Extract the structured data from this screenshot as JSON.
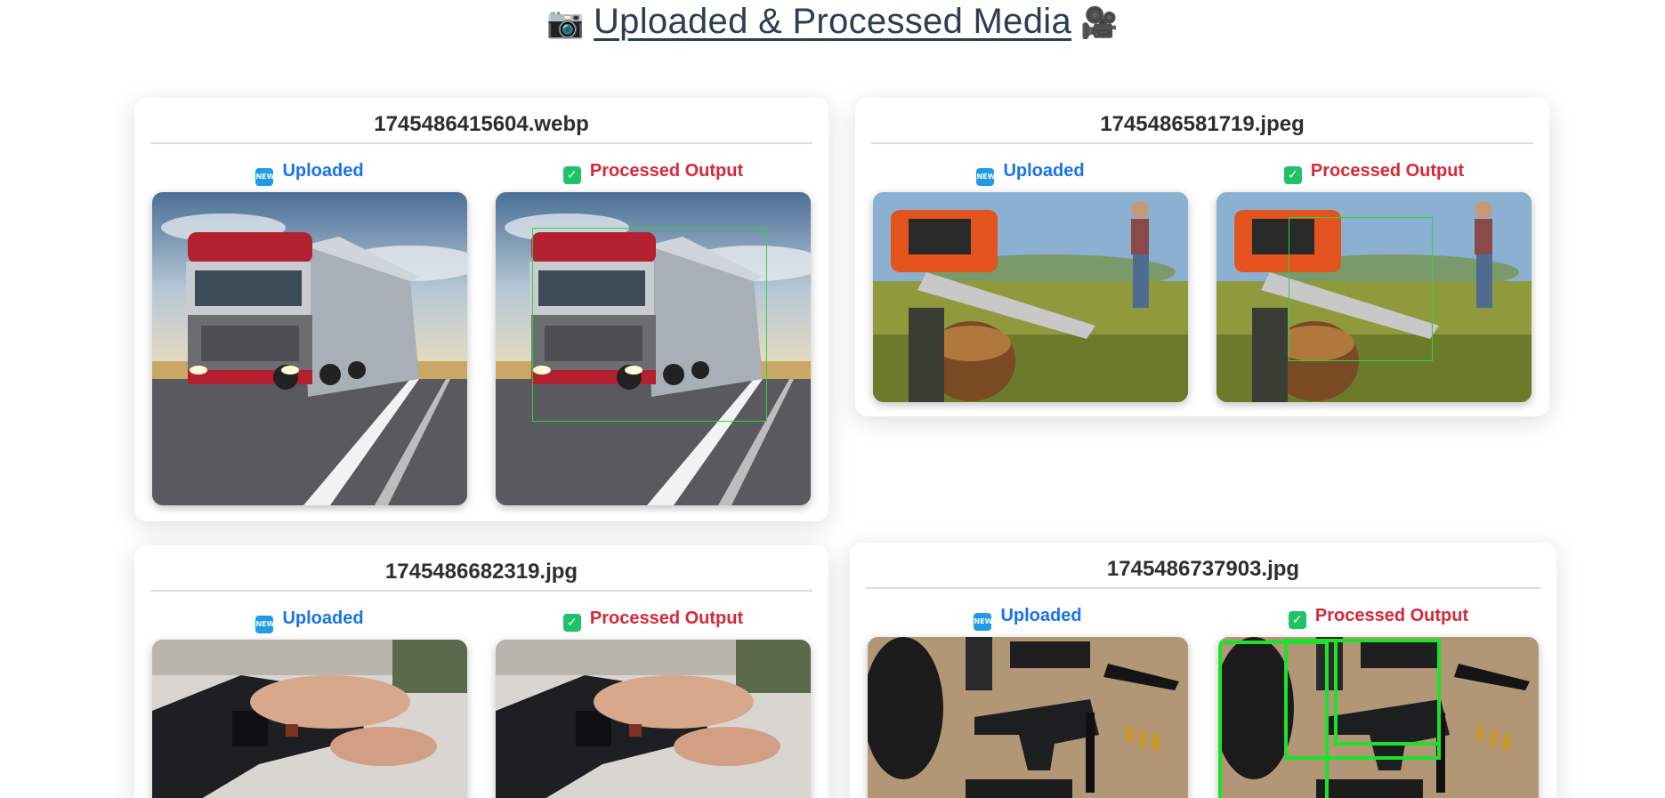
{
  "page": {
    "title": "Uploaded & Processed Media",
    "left_icon": "camera-icon",
    "right_icon": "film-projector-icon"
  },
  "labels": {
    "uploaded": "Uploaded",
    "processed": "Processed Output",
    "new_badge": "NEW",
    "check_badge": "✓"
  },
  "cards": [
    {
      "filename": "1745486415604.webp",
      "subject": "red semi truck on highway"
    },
    {
      "filename": "1745486581719.jpeg",
      "subject": "chainsaw cutting log, man with axe"
    },
    {
      "filename": "1745486682319.jpg",
      "subject": "hands holding pistol"
    },
    {
      "filename": "1745486737903.jpg",
      "subject": "pistols, knives, cartridges on burlap"
    }
  ],
  "colors": {
    "uploaded_label": "#1a73e8",
    "processed_label": "#d62839",
    "detection_box": "#2cd63b"
  }
}
